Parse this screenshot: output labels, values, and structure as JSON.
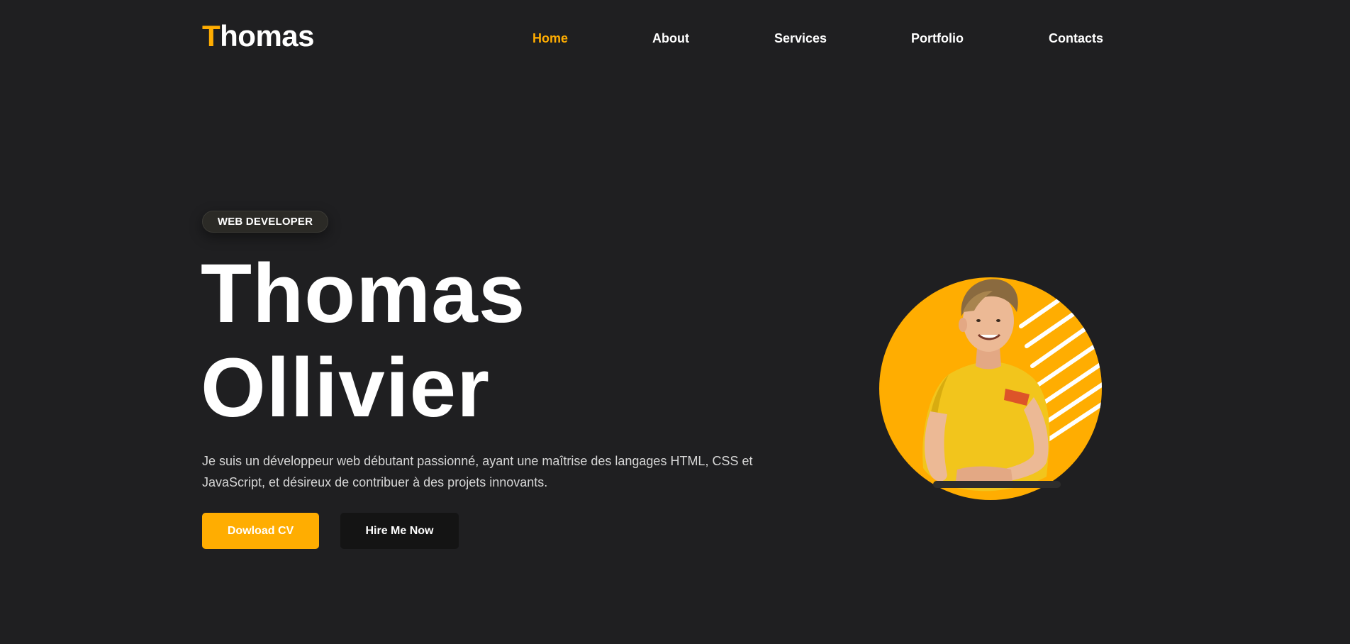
{
  "header": {
    "logo_initial": "T",
    "logo_rest": "homas",
    "nav": [
      {
        "label": "Home",
        "active": true
      },
      {
        "label": "About",
        "active": false
      },
      {
        "label": "Services",
        "active": false
      },
      {
        "label": "Portfolio",
        "active": false
      },
      {
        "label": "Contacts",
        "active": false
      }
    ]
  },
  "hero": {
    "badge": "WEB DEVELOPER",
    "first_name": "Thomas",
    "last_name": "Ollivier",
    "bio": "Je suis un développeur web débutant passionné, ayant une maîtrise des langages HTML, CSS et JavaScript, et désireux de contribuer à des projets innovants.",
    "download_button": "Dowload CV",
    "hire_button": "Hire Me Now"
  },
  "colors": {
    "accent": "#ffad01",
    "background": "#1f1f21",
    "dark_button": "#141414"
  },
  "icons": {
    "portrait": "profile-photo"
  }
}
